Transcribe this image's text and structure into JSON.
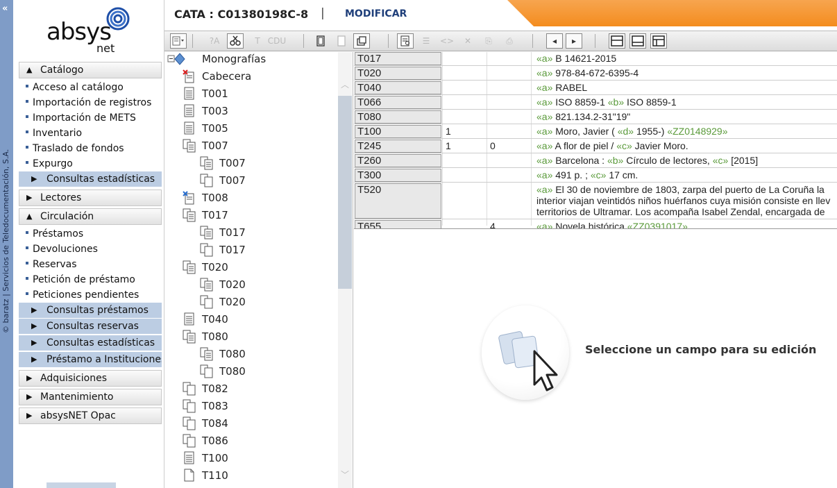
{
  "sidebar_strip": {
    "collapse_glyph": "«",
    "vertical_text": "© baratz | Servicios de Teledocumentación, S.A."
  },
  "logo": {
    "brand": "absys",
    "suffix": "net"
  },
  "nav": {
    "catalogo": {
      "label": "Catálogo",
      "items": [
        "Acceso al catálogo",
        "Importación de registros",
        "Importación de METS",
        "Inventario",
        "Traslado de fondos",
        "Expurgo"
      ],
      "sub": [
        "Consultas estadísticas"
      ]
    },
    "lectores": {
      "label": "Lectores"
    },
    "circulacion": {
      "label": "Circulación",
      "items": [
        "Préstamos",
        "Devoluciones",
        "Reservas",
        "Petición de préstamo",
        "Peticiones pendientes"
      ],
      "sub": [
        "Consultas préstamos",
        "Consultas reservas",
        "Consultas estadísticas",
        "Préstamo a Instituciones"
      ]
    },
    "adquisiciones": {
      "label": "Adquisiciones"
    },
    "mantenimiento": {
      "label": "Mantenimiento"
    },
    "opac": {
      "label": "absysNET Opac"
    }
  },
  "header": {
    "record_code": "CATA : C01380198C-8",
    "separator": "|",
    "mode": "MODIFICAR"
  },
  "toolbar": {
    "nav_prev": "◂",
    "nav_next": "▸",
    "icons": [
      "record-menu-icon",
      "insert-field-icon",
      "find-replace-icon",
      "tools-icon",
      "text-icon",
      "cdu-icon",
      "copy-icon",
      "paste-icon",
      "clipboard-icon",
      "preview-icon",
      "list-icon",
      "tag-icon",
      "delete-icon",
      "export-icon",
      "print-icon",
      "prev-icon",
      "next-icon",
      "layout-1-icon",
      "layout-2-icon",
      "layout-3-icon"
    ]
  },
  "tree": {
    "nodes": [
      {
        "label": "Monografías",
        "level": 0,
        "icon": "root"
      },
      {
        "label": "Cabecera",
        "level": 1,
        "icon": "header"
      },
      {
        "label": "T001",
        "level": 1,
        "icon": "doc"
      },
      {
        "label": "T003",
        "level": 1,
        "icon": "doc"
      },
      {
        "label": "T005",
        "level": 1,
        "icon": "doc"
      },
      {
        "label": "T007",
        "level": 1,
        "icon": "multi"
      },
      {
        "label": "T007",
        "level": 2,
        "icon": "multi"
      },
      {
        "label": "T007",
        "level": 2,
        "icon": "copy"
      },
      {
        "label": "T008",
        "level": 1,
        "icon": "special"
      },
      {
        "label": "T017",
        "level": 1,
        "icon": "multi"
      },
      {
        "label": "T017",
        "level": 2,
        "icon": "multi"
      },
      {
        "label": "T017",
        "level": 2,
        "icon": "copy"
      },
      {
        "label": "T020",
        "level": 1,
        "icon": "multi"
      },
      {
        "label": "T020",
        "level": 2,
        "icon": "multi"
      },
      {
        "label": "T020",
        "level": 2,
        "icon": "copy"
      },
      {
        "label": "T040",
        "level": 1,
        "icon": "doc"
      },
      {
        "label": "T080",
        "level": 1,
        "icon": "multi"
      },
      {
        "label": "T080",
        "level": 2,
        "icon": "multi"
      },
      {
        "label": "T080",
        "level": 2,
        "icon": "copy"
      },
      {
        "label": "T082",
        "level": 1,
        "icon": "copy"
      },
      {
        "label": "T083",
        "level": 1,
        "icon": "copy"
      },
      {
        "label": "T084",
        "level": 1,
        "icon": "copy"
      },
      {
        "label": "T086",
        "level": 1,
        "icon": "copy"
      },
      {
        "label": "T100",
        "level": 1,
        "icon": "doc"
      },
      {
        "label": "T110",
        "level": 1,
        "icon": "blank"
      }
    ]
  },
  "record": {
    "rows": [
      {
        "tag": "T017",
        "i1": "",
        "i2": "",
        "parts": [
          [
            "«a»",
            "B 14621-2015"
          ]
        ]
      },
      {
        "tag": "T020",
        "i1": "",
        "i2": "",
        "parts": [
          [
            "«a»",
            "978-84-672-6395-4"
          ]
        ]
      },
      {
        "tag": "T040",
        "i1": "",
        "i2": "",
        "parts": [
          [
            "«a»",
            "RABEL"
          ]
        ]
      },
      {
        "tag": "T066",
        "i1": "",
        "i2": "",
        "parts": [
          [
            "«a»",
            "ISO 8859-1 "
          ],
          [
            "«b»",
            "ISO 8859-1"
          ]
        ]
      },
      {
        "tag": "T080",
        "i1": "",
        "i2": "",
        "parts": [
          [
            "«a»",
            "821.134.2-31\"19\""
          ]
        ]
      },
      {
        "tag": "T100",
        "i1": "1",
        "i2": "",
        "parts": [
          [
            "«a»",
            "Moro, Javier ( "
          ],
          [
            "«d»",
            "1955-) "
          ],
          [
            "«ZZ0148929»",
            ""
          ]
        ]
      },
      {
        "tag": "T245",
        "i1": "1",
        "i2": "0",
        "parts": [
          [
            "«a»",
            "A flor de piel / "
          ],
          [
            "«c»",
            "Javier Moro."
          ]
        ]
      },
      {
        "tag": "T260",
        "i1": "",
        "i2": "",
        "parts": [
          [
            "«a»",
            "Barcelona : "
          ],
          [
            "«b»",
            "Círculo de lectores, "
          ],
          [
            "«c»",
            "[2015]"
          ]
        ]
      },
      {
        "tag": "T300",
        "i1": "",
        "i2": "",
        "parts": [
          [
            "«a»",
            "491 p. ; "
          ],
          [
            "«c»",
            "17 cm."
          ]
        ]
      },
      {
        "tag": "T520",
        "i1": "",
        "i2": "",
        "lines": [
          "El 30 de noviembre de 1803, zarpa del puerto de La Coruña la",
          "interior viajan veintidós niños huérfanos cuya misión consiste en llev",
          "territorios de Ultramar. Los acompaña Isabel Zendal, encargada de"
        ],
        "prefix": "«a»"
      },
      {
        "tag": "T655",
        "i1": "",
        "i2": "4",
        "parts": [
          [
            "«a»",
            "Novela histórica "
          ],
          [
            "«ZZ0391017»",
            " ."
          ]
        ]
      }
    ]
  },
  "hint": {
    "text": "Seleccione un campo para su edición"
  },
  "colors": {
    "strip": "#7f9cc7",
    "nav_sub": "#bccde3",
    "orange": "#f48c1e",
    "subfield": "#5a9a3a",
    "mode": "#1f3f7a"
  }
}
